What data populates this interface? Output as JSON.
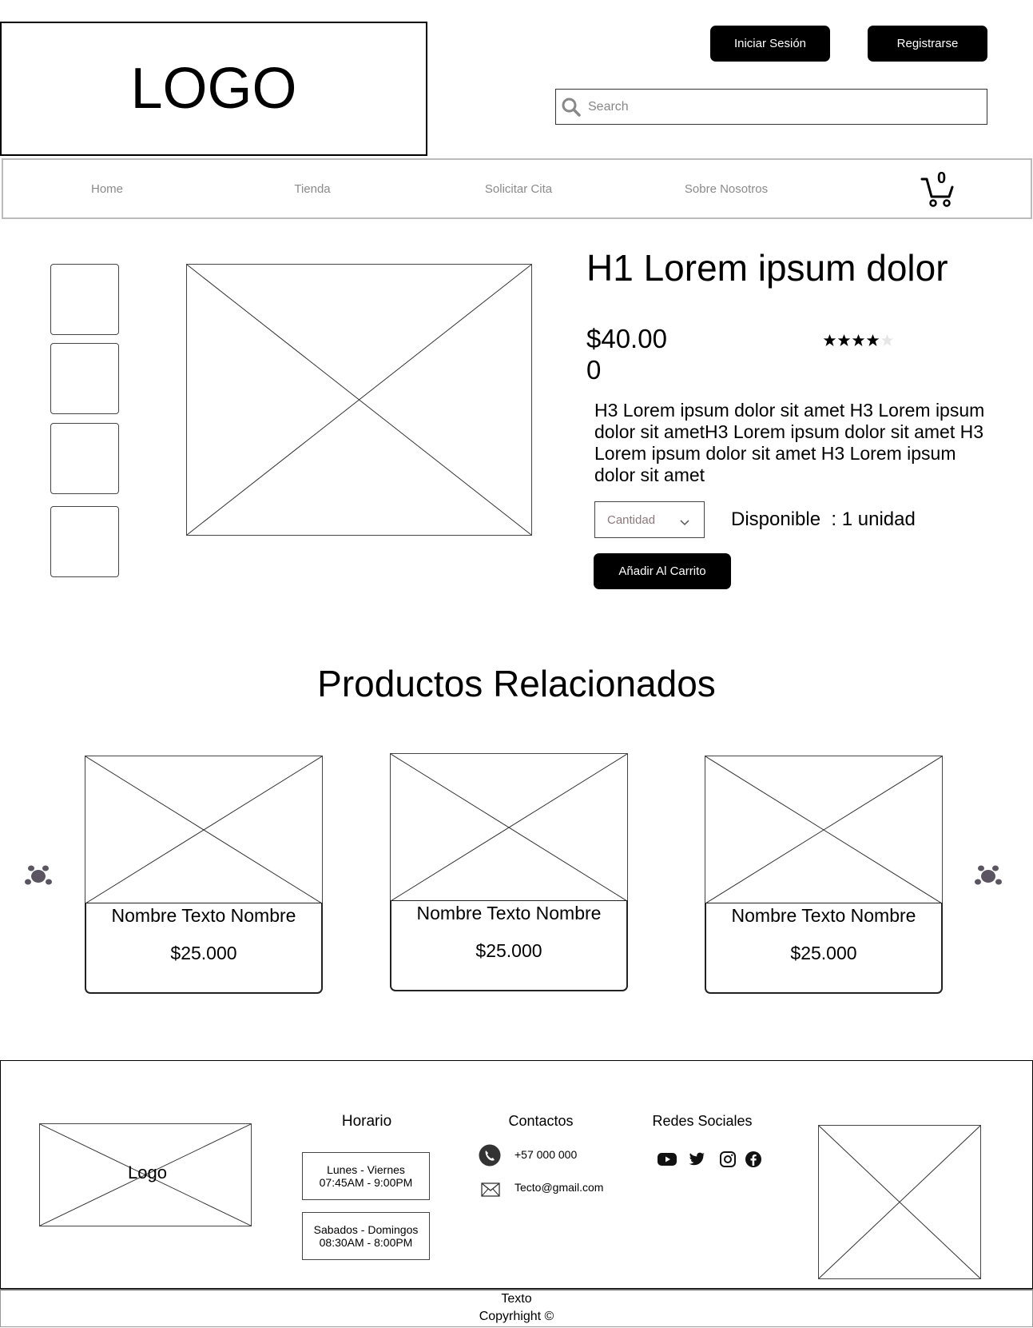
{
  "header": {
    "logo_text": "LOGO",
    "login_label": "Iniciar Sesión",
    "register_label": "Registrarse",
    "search_placeholder": "Search"
  },
  "nav": {
    "items": [
      "Home",
      "Tienda",
      "Solicitar Cita",
      "Sobre Nosotros"
    ],
    "cart_count": "0"
  },
  "product": {
    "title": "H1 Lorem ipsum dolor",
    "price": "$40.000",
    "rating": 4,
    "rating_max": 5,
    "description": "H3 Lorem ipsum dolor sit amet H3 Lorem ipsum dolor sit ametH3 Lorem ipsum dolor sit amet H3 Lorem ipsum dolor sit amet H3 Lorem ipsum dolor sit amet",
    "quantity_placeholder": "Cantidad",
    "availability": "Disponible  : 1 unidad",
    "add_to_cart_label": "Añadir Al Carrito"
  },
  "related": {
    "title": "Productos Relacionados",
    "items": [
      {
        "name": "Nombre Texto Nombre",
        "price": "$25.000"
      },
      {
        "name": "Nombre Texto Nombre",
        "price": "$25.000"
      },
      {
        "name": "Nombre Texto Nombre",
        "price": "$25.000"
      }
    ]
  },
  "footer": {
    "logo_text": "Logo",
    "hours_title": "Horario",
    "hours": [
      {
        "days": "Lunes - Viernes",
        "time": "07:45AM - 9:00PM"
      },
      {
        "days": "Sabados - Domingos",
        "time": "08:30AM - 8:00PM"
      }
    ],
    "contacts_title": "Contactos",
    "phone": "+57 000 000",
    "email": "Tecto@gmail.com",
    "social_title": "Redes Sociales",
    "copy_text": "Texto",
    "copyright": "Copyrhight ©"
  },
  "colors": {
    "accent": "#000000",
    "nav_text": "#8a8a8a",
    "star_empty": "#e6e6e6",
    "paw": "#5a5560"
  }
}
